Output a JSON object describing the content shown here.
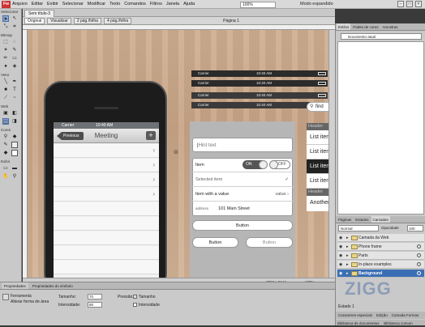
{
  "menubar": {
    "logo": "Fw",
    "menus": [
      "Arquivo",
      "Editar",
      "Exibir",
      "Selecionar",
      "Modificar",
      "Texto",
      "Comandos",
      "Filtros",
      "Janela",
      "Ajuda"
    ],
    "zoom": "100%",
    "workspace_mode": "Modo expandido"
  },
  "toolbox": {
    "sections": [
      "Selecionar",
      "Bitmap",
      "Vetor",
      "Web",
      "Cores",
      "Exibir"
    ]
  },
  "document": {
    "tab": "Sem título-3",
    "subtabs": [
      "Original",
      "Visualizar",
      "2 pág./folha",
      "4 pág./folha"
    ],
    "page": "Página 1"
  },
  "phone": {
    "status_carrier": "Carrier",
    "status_time": "10:40 AM",
    "back_label": "Previous",
    "title": "Meeting",
    "add_label": "+",
    "rows": 8
  },
  "strips": [
    {
      "carrier": "Carrier",
      "time": "10:40 AM"
    },
    {
      "carrier": "Carrier",
      "time": "10:40 AM"
    },
    {
      "carrier": "Carrier",
      "time": "10:40 AM"
    },
    {
      "carrier": "Carrier",
      "time": "10:40 AM"
    }
  ],
  "search": {
    "text": "find"
  },
  "form": {
    "hint": "Hint text",
    "item_label": "Item",
    "toggle_on": "ON",
    "toggle_off": "OFF",
    "selected_item": "Selected item",
    "item_with_value": "Item with a value",
    "value": "value",
    "address_label": "address",
    "address_value": "101 Main Street",
    "button_wide": "Button",
    "button_left": "Button",
    "button_right": "Button"
  },
  "table": {
    "header1": "Header",
    "rows1": [
      "List item",
      "List item",
      "List item"
    ],
    "header2": "Header",
    "row2": "List item",
    "row3": "Another"
  },
  "canvas_status": {
    "size": "3052 x 2144",
    "zoom": "100%"
  },
  "properties": {
    "tabs": [
      "Propriedades",
      "Propriedades do símbolo"
    ],
    "tool_name": "Ferramenta",
    "tool_desc": "Alterar forma de área",
    "size_label": "Tamanho:",
    "size_value": "70",
    "intensity_label": "Intensidade:",
    "intensity_value": "80",
    "pressure_label": "Pressão:",
    "pressure_size": "Tamanho",
    "pressure_intensity": "Intensidade"
  },
  "right_panel": {
    "top_tabs": [
      "Estilos",
      "Paleta de cores",
      "Amostras"
    ],
    "doc_select": "Documento atual",
    "layer_tabs": [
      "Páginas",
      "Estados",
      "Camadas"
    ],
    "blend": "Normal",
    "opacity_label": "Opacidade",
    "opacity_value": "100",
    "layers": [
      "Camada da Web",
      "Phone frame",
      "Parts",
      "In-place examples",
      "Background"
    ],
    "state": "Estado 1",
    "bottom_tabs": [
      "Caracteres especiais",
      "Edição",
      "Camada Formas"
    ],
    "bottom_tabs2": [
      "Biblioteca de documentos",
      "Biblioteca comum"
    ]
  },
  "watermark": "ZIGG"
}
